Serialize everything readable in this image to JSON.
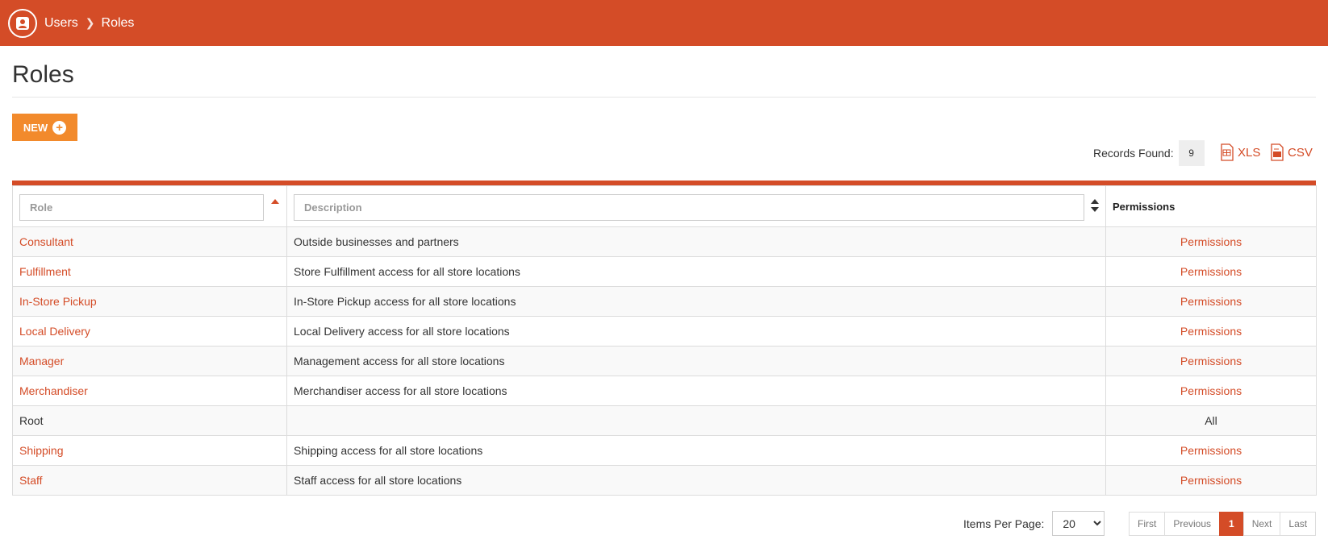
{
  "colors": {
    "brand": "#d44c27",
    "new_button": "#f28a2c"
  },
  "header": {
    "icon": "user-profile-icon",
    "breadcrumb": {
      "parent": "Users",
      "separator_icon": "chevron-right-icon",
      "current": "Roles"
    }
  },
  "page": {
    "title": "Roles"
  },
  "toolbar": {
    "new_label": "NEW",
    "new_icon": "plus-circle-icon",
    "records_label": "Records Found:",
    "records_count": "9",
    "export_xls": "XLS",
    "export_csv": "CSV"
  },
  "table": {
    "columns": {
      "role_placeholder": "Role",
      "description_placeholder": "Description",
      "permissions": "Permissions"
    },
    "rows": [
      {
        "role": "Consultant",
        "description": "Outside businesses and partners",
        "permissions": "Permissions"
      },
      {
        "role": "Fulfillment",
        "description": "Store Fulfillment access for all store locations",
        "permissions": "Permissions"
      },
      {
        "role": "In-Store Pickup",
        "description": "In-Store Pickup access for all store locations",
        "permissions": "Permissions"
      },
      {
        "role": "Local Delivery",
        "description": "Local Delivery access for all store locations",
        "permissions": "Permissions"
      },
      {
        "role": "Manager",
        "description": "Management access for all store locations",
        "permissions": "Permissions"
      },
      {
        "role": "Merchandiser",
        "description": "Merchandiser access for all store locations",
        "permissions": "Permissions"
      },
      {
        "role": "Root",
        "description": "",
        "permissions": "All"
      },
      {
        "role": "Shipping",
        "description": "Shipping access for all store locations",
        "permissions": "Permissions"
      },
      {
        "role": "Staff",
        "description": "Staff access for all store locations",
        "permissions": "Permissions"
      }
    ]
  },
  "footer": {
    "items_per_page_label": "Items Per Page:",
    "items_per_page_value": "20",
    "pager": {
      "first": "First",
      "previous": "Previous",
      "current": "1",
      "next": "Next",
      "last": "Last"
    }
  }
}
